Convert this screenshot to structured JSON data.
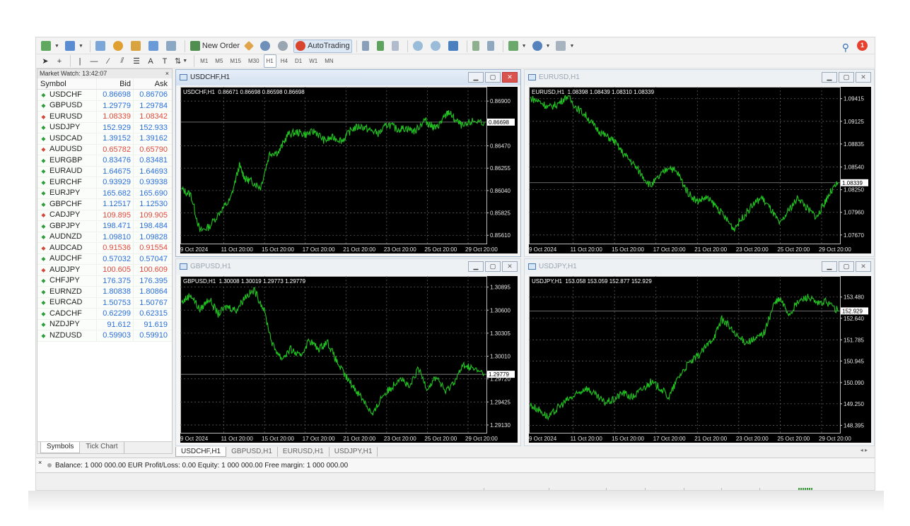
{
  "toolbar": {
    "new_order": "New Order",
    "autotrading": "AutoTrading",
    "alerts_count": "1",
    "timeframes": [
      "M1",
      "M5",
      "M15",
      "M30",
      "H1",
      "H4",
      "D1",
      "W1",
      "MN"
    ],
    "active_timeframe": "H1"
  },
  "market_watch": {
    "title": "Market Watch: 13:42:07",
    "close": "×",
    "col_symbol": "Symbol",
    "col_bid": "Bid",
    "col_ask": "Ask",
    "rows": [
      {
        "symbol": "USDCHF",
        "bid": "0.86698",
        "ask": "0.86706",
        "dir": "up"
      },
      {
        "symbol": "GBPUSD",
        "bid": "1.29779",
        "ask": "1.29784",
        "dir": "up"
      },
      {
        "symbol": "EURUSD",
        "bid": "1.08339",
        "ask": "1.08342",
        "dir": "dn"
      },
      {
        "symbol": "USDJPY",
        "bid": "152.929",
        "ask": "152.933",
        "dir": "up"
      },
      {
        "symbol": "USDCAD",
        "bid": "1.39152",
        "ask": "1.39162",
        "dir": "up"
      },
      {
        "symbol": "AUDUSD",
        "bid": "0.65782",
        "ask": "0.65790",
        "dir": "dn"
      },
      {
        "symbol": "EURGBP",
        "bid": "0.83476",
        "ask": "0.83481",
        "dir": "up"
      },
      {
        "symbol": "EURAUD",
        "bid": "1.64675",
        "ask": "1.64693",
        "dir": "up"
      },
      {
        "symbol": "EURCHF",
        "bid": "0.93929",
        "ask": "0.93938",
        "dir": "up"
      },
      {
        "symbol": "EURJPY",
        "bid": "165.682",
        "ask": "165.690",
        "dir": "up"
      },
      {
        "symbol": "GBPCHF",
        "bid": "1.12517",
        "ask": "1.12530",
        "dir": "up"
      },
      {
        "symbol": "CADJPY",
        "bid": "109.895",
        "ask": "109.905",
        "dir": "dn"
      },
      {
        "symbol": "GBPJPY",
        "bid": "198.471",
        "ask": "198.484",
        "dir": "up"
      },
      {
        "symbol": "AUDNZD",
        "bid": "1.09810",
        "ask": "1.09828",
        "dir": "up"
      },
      {
        "symbol": "AUDCAD",
        "bid": "0.91536",
        "ask": "0.91554",
        "dir": "dn"
      },
      {
        "symbol": "AUDCHF",
        "bid": "0.57032",
        "ask": "0.57047",
        "dir": "up"
      },
      {
        "symbol": "AUDJPY",
        "bid": "100.605",
        "ask": "100.609",
        "dir": "dn"
      },
      {
        "symbol": "CHFJPY",
        "bid": "176.375",
        "ask": "176.395",
        "dir": "up"
      },
      {
        "symbol": "EURNZD",
        "bid": "1.80838",
        "ask": "1.80864",
        "dir": "up"
      },
      {
        "symbol": "EURCAD",
        "bid": "1.50753",
        "ask": "1.50767",
        "dir": "up"
      },
      {
        "symbol": "CADCHF",
        "bid": "0.62299",
        "ask": "0.62315",
        "dir": "up"
      },
      {
        "symbol": "NZDJPY",
        "bid": "91.612",
        "ask": "91.619",
        "dir": "up"
      },
      {
        "symbol": "NZDUSD",
        "bid": "0.59903",
        "ask": "0.59910",
        "dir": "up"
      }
    ],
    "tabs": [
      "Symbols",
      "Tick Chart"
    ]
  },
  "chart_data": [
    {
      "type": "line",
      "window_title": "USDCHF,H1",
      "header": "USDCHF,H1  0.86671 0.86698 0.86598 0.86698",
      "active": true,
      "last_price": "0.86698",
      "last_value": 0.86698,
      "ylim": [
        0.8553,
        0.8701
      ],
      "y_ticks": [
        "0.86900",
        "0.86698",
        "0.86470",
        "0.86255",
        "0.86040",
        "0.85825",
        "0.85610"
      ],
      "x_ticks": [
        "9 Oct 2024",
        "11 Oct 20:00",
        "15 Oct 20:00",
        "17 Oct 20:00",
        "21 Oct 20:00",
        "23 Oct 20:00",
        "25 Oct 20:00",
        "29 Oct 20:00"
      ],
      "path": [
        [
          0,
          0.8605
        ],
        [
          0.03,
          0.86
        ],
        [
          0.06,
          0.8565
        ],
        [
          0.09,
          0.8569
        ],
        [
          0.13,
          0.8585
        ],
        [
          0.16,
          0.8595
        ],
        [
          0.19,
          0.8628
        ],
        [
          0.21,
          0.8615
        ],
        [
          0.23,
          0.8613
        ],
        [
          0.26,
          0.8607
        ],
        [
          0.29,
          0.864
        ],
        [
          0.32,
          0.8641
        ],
        [
          0.35,
          0.8658
        ],
        [
          0.38,
          0.866
        ],
        [
          0.41,
          0.8658
        ],
        [
          0.44,
          0.8661
        ],
        [
          0.47,
          0.8652
        ],
        [
          0.5,
          0.8655
        ],
        [
          0.53,
          0.8652
        ],
        [
          0.56,
          0.8663
        ],
        [
          0.59,
          0.8666
        ],
        [
          0.62,
          0.8662
        ],
        [
          0.65,
          0.8659
        ],
        [
          0.68,
          0.8668
        ],
        [
          0.71,
          0.8663
        ],
        [
          0.74,
          0.8664
        ],
        [
          0.77,
          0.8661
        ],
        [
          0.8,
          0.8672
        ],
        [
          0.82,
          0.8667
        ],
        [
          0.84,
          0.8664
        ],
        [
          0.86,
          0.8672
        ],
        [
          0.88,
          0.868
        ],
        [
          0.9,
          0.8672
        ],
        [
          0.93,
          0.8665
        ],
        [
          0.96,
          0.8671
        ],
        [
          1,
          0.86698
        ]
      ]
    },
    {
      "type": "line",
      "window_title": "EURUSD,H1",
      "header": "EURUSD,H1  1.08398 1.08439 1.08310 1.08339",
      "active": false,
      "last_price": "1.08339",
      "last_value": 1.08339,
      "ylim": [
        1.0756,
        1.0953
      ],
      "y_ticks": [
        "1.09415",
        "1.09125",
        "1.08835",
        "1.08540",
        "1.08339",
        "1.08250",
        "1.07960",
        "1.07670"
      ],
      "x_ticks": [
        "9 Oct 2024",
        "11 Oct 20:00",
        "15 Oct 20:00",
        "17 Oct 20:00",
        "21 Oct 20:00",
        "23 Oct 20:00",
        "25 Oct 20:00",
        "29 Oct 20:00"
      ],
      "path": [
        [
          0,
          1.0942
        ],
        [
          0.03,
          1.0938
        ],
        [
          0.06,
          1.093
        ],
        [
          0.09,
          1.0935
        ],
        [
          0.12,
          1.0945
        ],
        [
          0.15,
          1.093
        ],
        [
          0.18,
          1.092
        ],
        [
          0.21,
          1.0905
        ],
        [
          0.24,
          1.0895
        ],
        [
          0.27,
          1.0888
        ],
        [
          0.3,
          1.0872
        ],
        [
          0.33,
          1.086
        ],
        [
          0.36,
          1.0845
        ],
        [
          0.39,
          1.083
        ],
        [
          0.42,
          1.0842
        ],
        [
          0.45,
          1.0855
        ],
        [
          0.48,
          1.0845
        ],
        [
          0.51,
          1.0822
        ],
        [
          0.54,
          1.081
        ],
        [
          0.57,
          1.0815
        ],
        [
          0.6,
          1.0805
        ],
        [
          0.63,
          1.079
        ],
        [
          0.66,
          1.0775
        ],
        [
          0.69,
          1.079
        ],
        [
          0.72,
          1.0805
        ],
        [
          0.75,
          1.0815
        ],
        [
          0.78,
          1.08
        ],
        [
          0.81,
          1.078
        ],
        [
          0.84,
          1.08
        ],
        [
          0.87,
          1.0815
        ],
        [
          0.9,
          1.08
        ],
        [
          0.93,
          1.079
        ],
        [
          0.95,
          1.0805
        ],
        [
          0.97,
          1.082
        ],
        [
          1,
          1.08339
        ]
      ]
    },
    {
      "type": "line",
      "window_title": "GBPUSD,H1",
      "header": "GBPUSD,H1  1.30008 1.30019 1.29773 1.29779",
      "active": false,
      "last_price": "1.29779",
      "last_value": 1.29779,
      "ylim": [
        1.2903,
        1.31
      ],
      "y_ticks": [
        "1.30895",
        "1.30600",
        "1.30305",
        "1.30010",
        "1.29779",
        "1.29720",
        "1.29425",
        "1.29130"
      ],
      "x_ticks": [
        "9 Oct 2024",
        "11 Oct 20:00",
        "15 Oct 20:00",
        "17 Oct 20:00",
        "21 Oct 20:00",
        "23 Oct 20:00",
        "25 Oct 20:00",
        "29 Oct 20:00"
      ],
      "path": [
        [
          0,
          1.307
        ],
        [
          0.03,
          1.308
        ],
        [
          0.06,
          1.306
        ],
        [
          0.09,
          1.3075
        ],
        [
          0.12,
          1.3055
        ],
        [
          0.15,
          1.3065
        ],
        [
          0.18,
          1.306
        ],
        [
          0.21,
          1.3078
        ],
        [
          0.24,
          1.3085
        ],
        [
          0.27,
          1.3062
        ],
        [
          0.3,
          1.3015
        ],
        [
          0.33,
          1.2998
        ],
        [
          0.36,
          1.301
        ],
        [
          0.39,
          1.3
        ],
        [
          0.42,
          1.3022
        ],
        [
          0.45,
          1.301
        ],
        [
          0.48,
          1.302
        ],
        [
          0.51,
          1.2995
        ],
        [
          0.54,
          1.2975
        ],
        [
          0.57,
          1.296
        ],
        [
          0.6,
          1.2945
        ],
        [
          0.63,
          1.2925
        ],
        [
          0.66,
          1.295
        ],
        [
          0.69,
          1.296
        ],
        [
          0.72,
          1.2975
        ],
        [
          0.75,
          1.296
        ],
        [
          0.78,
          1.2985
        ],
        [
          0.81,
          1.296
        ],
        [
          0.84,
          1.2975
        ],
        [
          0.87,
          1.2955
        ],
        [
          0.9,
          1.297
        ],
        [
          0.93,
          1.299
        ],
        [
          0.96,
          1.2985
        ],
        [
          1,
          1.29779
        ]
      ]
    },
    {
      "type": "line",
      "window_title": "USDJPY,H1",
      "header": "USDJPY,H1  153.058 153.059 152.877 152.929",
      "active": false,
      "last_price": "152.929",
      "last_value": 152.929,
      "ylim": [
        148.1,
        154.2
      ],
      "y_ticks": [
        "153.480",
        "152.929",
        "152.640",
        "151.785",
        "150.945",
        "150.090",
        "149.250",
        "148.395"
      ],
      "x_ticks": [
        "9 Oct 2024",
        "11 Oct 20:00",
        "15 Oct 20:00",
        "17 Oct 20:00",
        "21 Oct 20:00",
        "23 Oct 20:00",
        "25 Oct 20:00",
        "29 Oct 20:00"
      ],
      "path": [
        [
          0,
          149.2
        ],
        [
          0.03,
          149.0
        ],
        [
          0.06,
          148.7
        ],
        [
          0.09,
          149.1
        ],
        [
          0.12,
          149.4
        ],
        [
          0.15,
          149.6
        ],
        [
          0.18,
          149.9
        ],
        [
          0.21,
          149.6
        ],
        [
          0.24,
          149.3
        ],
        [
          0.27,
          149.4
        ],
        [
          0.3,
          149.7
        ],
        [
          0.33,
          149.5
        ],
        [
          0.36,
          149.8
        ],
        [
          0.39,
          150.1
        ],
        [
          0.42,
          149.9
        ],
        [
          0.45,
          149.5
        ],
        [
          0.48,
          150.3
        ],
        [
          0.51,
          150.8
        ],
        [
          0.54,
          151.1
        ],
        [
          0.57,
          151.5
        ],
        [
          0.6,
          152.0
        ],
        [
          0.62,
          152.6
        ],
        [
          0.64,
          152.4
        ],
        [
          0.67,
          151.9
        ],
        [
          0.7,
          151.7
        ],
        [
          0.73,
          151.8
        ],
        [
          0.76,
          152.1
        ],
        [
          0.79,
          153.2
        ],
        [
          0.81,
          153.4
        ],
        [
          0.84,
          152.8
        ],
        [
          0.87,
          153.3
        ],
        [
          0.9,
          153.5
        ],
        [
          0.93,
          153.2
        ],
        [
          0.96,
          153.3
        ],
        [
          1,
          152.929
        ]
      ]
    }
  ],
  "chart_tabs": [
    "USDCHF,H1",
    "GBPUSD,H1",
    "EURUSD,H1",
    "USDJPY,H1"
  ],
  "active_chart_tab": "USDCHF,H1",
  "tab_nav": "◂ ▸",
  "terminal": {
    "close": "×",
    "summary": "Balance: 1 000 000.00 EUR  Profit/Loss: 0.00  Equity: 1 000 000.00  Free margin: 1 000 000.00"
  },
  "colors": {
    "line": "#21c421",
    "grid": "#5a5a5a",
    "chart_bg": "#000000",
    "up": "#2a6fdb",
    "down": "#e14a3b"
  }
}
